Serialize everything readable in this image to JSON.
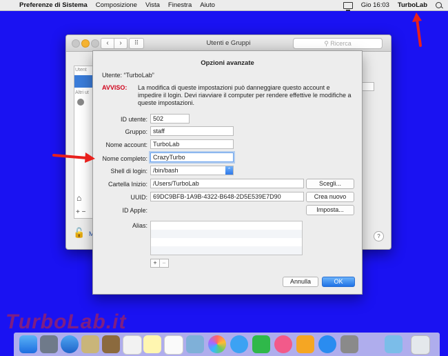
{
  "menubar": {
    "app": "Preferenze di Sistema",
    "items": [
      "Composizione",
      "Vista",
      "Finestra",
      "Aiuto"
    ],
    "clock": "Gio 16:03",
    "user": "TurboLab"
  },
  "window": {
    "title": "Utenti e Gruppi",
    "search_placeholder": "Ricerca",
    "sidebar_header1": "Utent",
    "sidebar_header2": "Altri ut",
    "lock_text": "M",
    "help": "?"
  },
  "sheet": {
    "title": "Opzioni avanzate",
    "user_line": "Utente: “TurboLab”",
    "warning_label": "AVVISO:",
    "warning_text": "La modifica di queste impostazioni può danneggiare questo account e impedire il login. Devi riavviare il computer per rendere effettive le modifiche a queste impostazioni.",
    "fields": {
      "id_label": "ID utente:",
      "id_value": "502",
      "group_label": "Gruppo:",
      "group_value": "staff",
      "account_label": "Nome account:",
      "account_value": "TurboLab",
      "fullname_label": "Nome completo:",
      "fullname_value": "CrazyTurbo",
      "shell_label": "Shell di login:",
      "shell_value": "/bin/bash",
      "home_label": "Cartella Inizio:",
      "home_value": "/Users/TurboLab",
      "uuid_label": "UUID:",
      "uuid_value": "69DC9BFB-1A9B-4322-B648-2D5E539E7D90",
      "appleid_label": "ID Apple:",
      "alias_label": "Alias:"
    },
    "buttons": {
      "choose": "Scegli...",
      "create_new": "Crea nuovo",
      "set": "Imposta...",
      "cancel": "Annulla",
      "ok": "OK",
      "add": "+",
      "remove": "−"
    }
  },
  "watermark": "TurboLab.it",
  "colors": {
    "desktop": "#1a12f2",
    "arrow": "#e8201c",
    "accent": "#2f79e9",
    "warning": "#d0021b"
  },
  "icons": [
    "apple-icon",
    "display-icon",
    "search-icon",
    "lock-icon",
    "help-icon",
    "home-icon"
  ]
}
